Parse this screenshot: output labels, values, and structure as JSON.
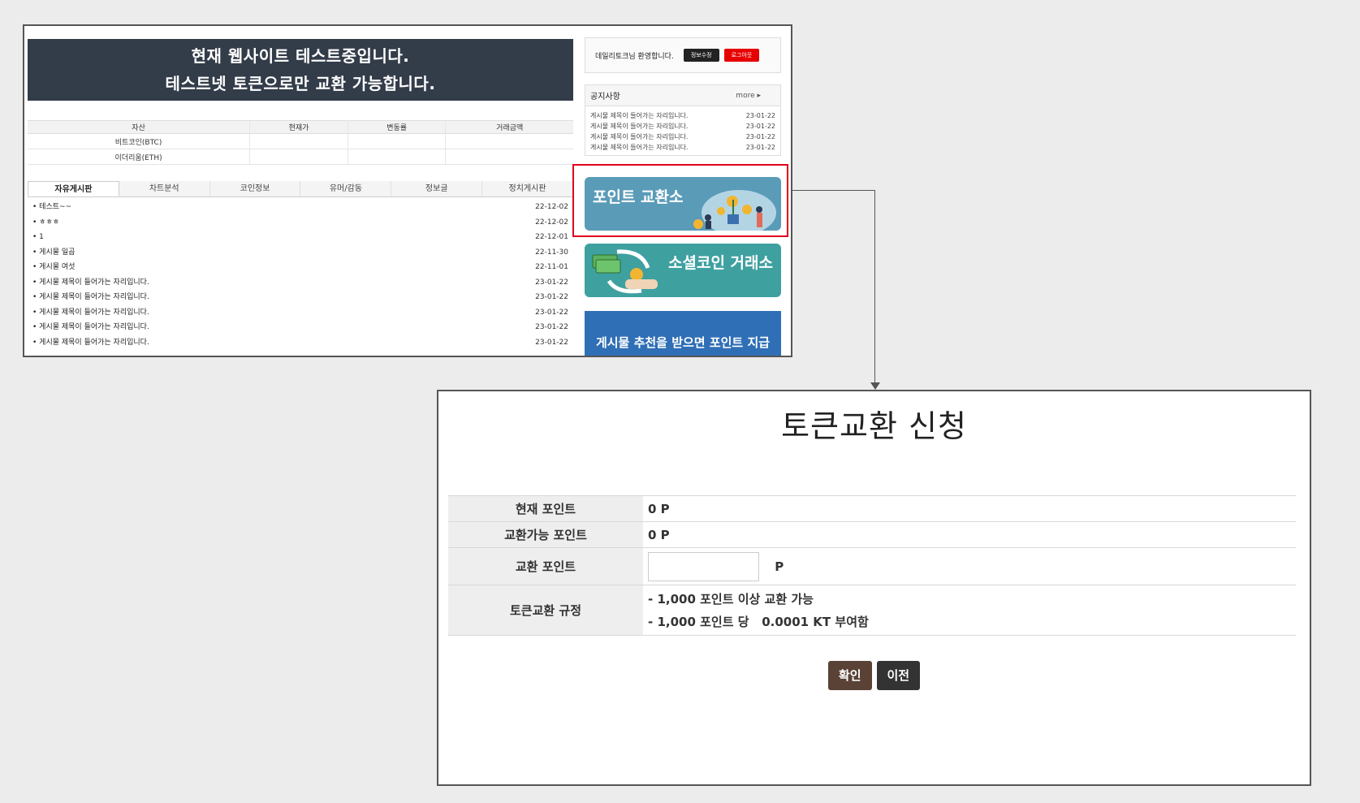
{
  "site": {
    "banner": [
      "현재 웹사이트 테스트중입니다.",
      "테스트넷 토큰으로만 교환 가능합니다."
    ],
    "asset_table": {
      "headers": [
        "자산",
        "현재가",
        "변동률",
        "거래금액"
      ],
      "rows": [
        [
          "비트코인(BTC)",
          "",
          "",
          ""
        ],
        [
          "이더리움(ETH)",
          "",
          "",
          ""
        ]
      ]
    },
    "board_tabs": [
      "자유게시판",
      "차트분석",
      "코인정보",
      "유머/감동",
      "정보글",
      "정치게시판"
    ],
    "board_rows": [
      {
        "title": "• 테스트~~",
        "date": "22-12-02"
      },
      {
        "title": "• ㅎㅎㅎ",
        "date": "22-12-02"
      },
      {
        "title": "• 1",
        "date": "22-12-01"
      },
      {
        "title": "• 게시물 일곱",
        "date": "22-11-30"
      },
      {
        "title": "• 게시물 여섯",
        "date": "22-11-01"
      },
      {
        "title": "• 게시물 제목이 들어가는 자리입니다.",
        "date": "23-01-22"
      },
      {
        "title": "• 게시물 제목이 들어가는 자리입니다.",
        "date": "23-01-22"
      },
      {
        "title": "• 게시물 제목이 들어가는 자리입니다.",
        "date": "23-01-22"
      },
      {
        "title": "• 게시물 제목이 들어가는 자리입니다.",
        "date": "23-01-22"
      },
      {
        "title": "• 게시물 제목이 들어가는 자리입니다.",
        "date": "23-01-22"
      }
    ],
    "login": {
      "welcome": "데일리토크님 환영합니다.",
      "edit_label": "정보수정",
      "logout_label": "로그아웃"
    },
    "notice": {
      "title": "공지사항",
      "more": "more ▸",
      "rows": [
        {
          "title": "게시물 제목이 들어가는 자리입니다.",
          "date": "23-01-22"
        },
        {
          "title": "게시물 제목이 들어가는 자리입니다.",
          "date": "23-01-22"
        },
        {
          "title": "게시물 제목이 들어가는 자리입니다.",
          "date": "23-01-22"
        },
        {
          "title": "게시물 제목이 들어가는 자리입니다.",
          "date": "23-01-22"
        }
      ]
    },
    "promos": {
      "point_exchange": "포인트 교환소",
      "social_coin": "소셜코인 거래소",
      "recommend": "게시물 추천을 받으면 포인트 지급"
    },
    "highlight_color": "#e0001b"
  },
  "dialog": {
    "title": "토큰교환 신청",
    "rows": {
      "current_label": "현재 포인트",
      "current_value": "0 P",
      "available_label": "교환가능 포인트",
      "available_value": "0 P",
      "exchange_label": "교환 포인트",
      "exchange_value": "",
      "exchange_unit": "P",
      "rules_label": "토큰교환 규정",
      "rule_1": "- 1,000 포인트 이상 교환 가능",
      "rule_2": "- 1,000 포인트 당   0.0001 KT 부여함"
    },
    "confirm_label": "확인",
    "prev_label": "이전",
    "colors": {
      "confirm": "#5a4237",
      "prev": "#333333"
    }
  }
}
